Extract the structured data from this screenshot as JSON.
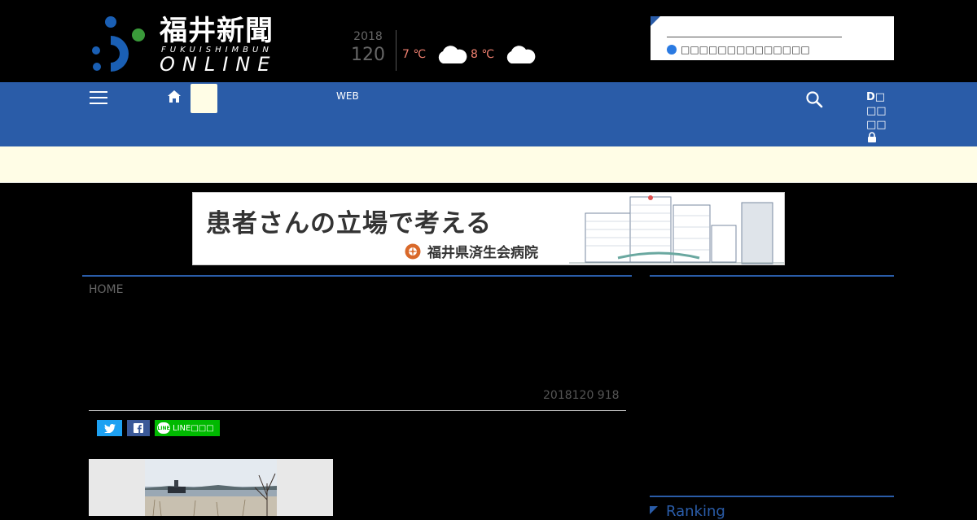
{
  "header": {
    "logo_title": "福井新聞",
    "logo_sub": "FUKUISHIMBUN",
    "logo_online": "ONLINE",
    "date_year": "2018",
    "date_day": "120",
    "weather": [
      {
        "temp": "7 ℃",
        "icon": "cloud-icon"
      },
      {
        "temp": "8 ℃",
        "icon": "cloud-icon"
      }
    ],
    "notice_text": "□□□□□□□□□□□□□□"
  },
  "nav": {
    "web_label": "WEB",
    "account_lines": [
      "D□",
      "□□",
      "□□"
    ]
  },
  "banner": {
    "headline": "患者さんの立場で考える",
    "hospital": "福井県済生会病院"
  },
  "article": {
    "breadcrumb": "HOME",
    "date": "2018120 918",
    "share_line_label": "LINE□□□"
  },
  "sidebar": {
    "ranking_title": "Ranking"
  },
  "colors": {
    "brand_blue": "#2a5ca8",
    "ticker_bg": "#fffde6",
    "twitter": "#1da1f2",
    "facebook": "#3b5998",
    "line": "#00b900",
    "temp": "#f08070"
  }
}
